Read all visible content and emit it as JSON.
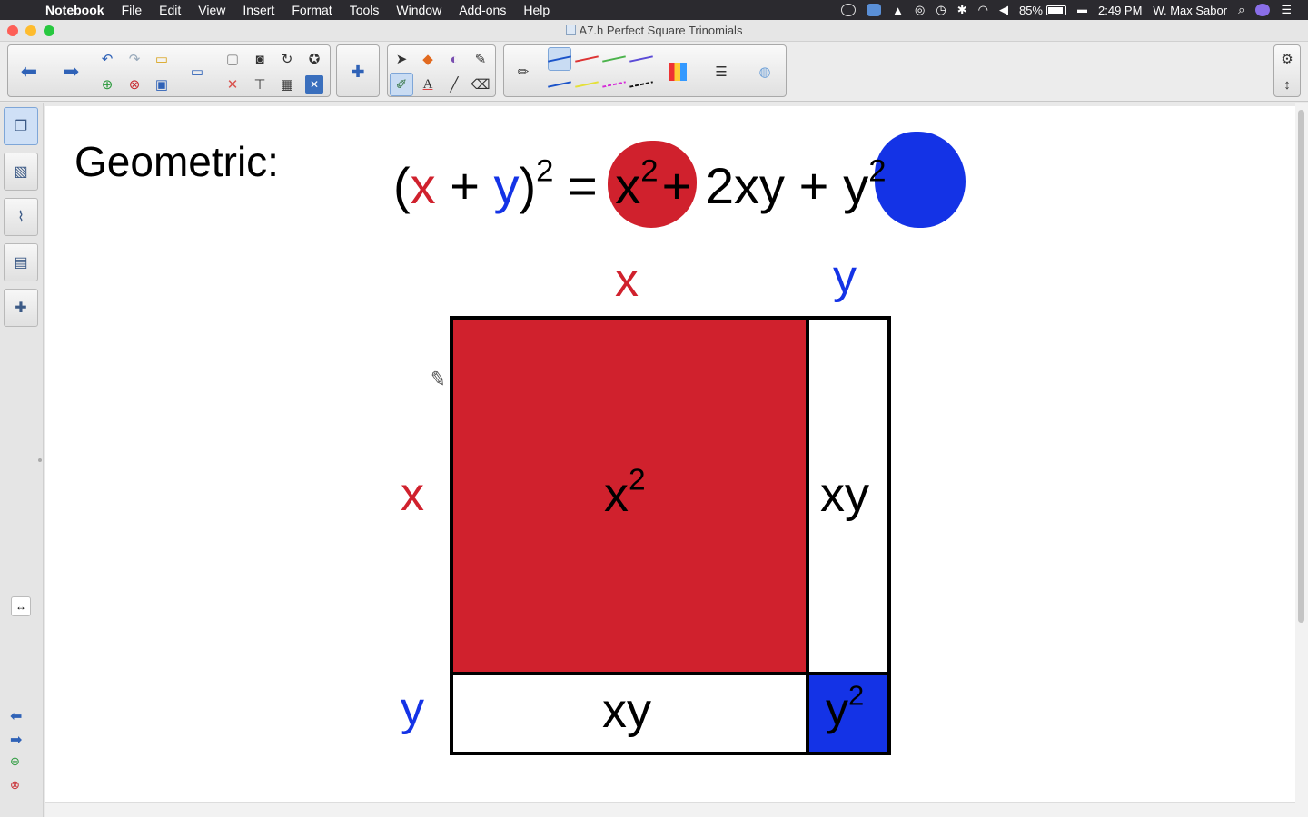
{
  "menubar": {
    "app": "Notebook",
    "menus": [
      "File",
      "Edit",
      "View",
      "Insert",
      "Format",
      "Tools",
      "Window",
      "Add-ons",
      "Help"
    ],
    "battery": "85%",
    "time": "2:49 PM",
    "user": "W. Max Sabor"
  },
  "window": {
    "title": "A7.h Perfect Square Trinomials"
  },
  "slide": {
    "heading": "Geometric:",
    "equation": {
      "open": "(",
      "x": "x",
      "plus1": " + ",
      "y": "y",
      "close": ")",
      "exp": "2",
      "equals": " = ",
      "term1_base": "x",
      "term1_exp": "2",
      "plus2": "+ ",
      "middle": "2xy",
      "plus3": " +",
      "term3_base": "y",
      "term3_exp": "2"
    },
    "top_labels": {
      "x": "x",
      "y": "y"
    },
    "side_labels": {
      "x": "x",
      "y": "y"
    },
    "cells": {
      "big_base": "x",
      "big_exp": "2",
      "right": "xy",
      "bottom": "xy",
      "small_base": "y",
      "small_exp": "2"
    }
  },
  "colors": {
    "red": "#d0212d",
    "blue": "#1433e6",
    "black": "#000000"
  },
  "icons": {
    "toolbar": [
      "back-arrow-icon",
      "forward-arrow-icon",
      "undo-icon",
      "redo-icon",
      "open-folder-icon",
      "add-page-icon",
      "delete-page-icon",
      "save-icon",
      "screen-shade-icon",
      "paste-icon",
      "delete-icon",
      "screen-capture-icon",
      "rotate-icon",
      "table-icon",
      "close-box-icon",
      "addons-icon",
      "select-arrow-icon",
      "shapes-icon",
      "fill-icon",
      "magic-pen-icon",
      "pens-icon",
      "text-icon",
      "line-icon",
      "eraser-icon",
      "pencil-icon",
      "color-palette-icon",
      "line-style-icon",
      "transparency-icon",
      "settings-gear-icon",
      "move-toolbar-icon"
    ],
    "sidebar": [
      "page-sorter-icon",
      "gallery-icon",
      "attachments-icon",
      "properties-icon",
      "addons-icon"
    ]
  }
}
